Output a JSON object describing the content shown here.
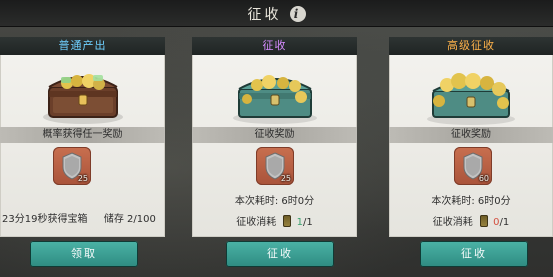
{
  "title": "征收",
  "colors": {
    "normal": "#6fd0ff",
    "collect": "#d68cff",
    "advanced": "#ffb24a",
    "button": "#2e8b81",
    "consume_ok": "#3aa06d",
    "consume_none": "#d34f3f"
  },
  "panels": [
    {
      "header": "普通产出",
      "band": "概率获得任一奖励",
      "reward_count": "25",
      "timer": "23分19秒获得宝箱",
      "storage": "储存 2/100",
      "button": "领取"
    },
    {
      "header": "征收",
      "band": "征收奖励",
      "reward_count": "25",
      "time_cost": "本次耗时: 6时0分",
      "consume_label": "征收消耗",
      "consume_have": "1",
      "consume_total": "/1",
      "button": "征收"
    },
    {
      "header": "高级征收",
      "band": "征收奖励",
      "reward_count": "60",
      "time_cost": "本次耗时: 6时0分",
      "consume_label": "征收消耗",
      "consume_have": "0",
      "consume_total": "/1",
      "button": "征收"
    }
  ],
  "icons": [
    "info-icon",
    "chest-icon",
    "reward-shield-icon",
    "token-icon"
  ]
}
